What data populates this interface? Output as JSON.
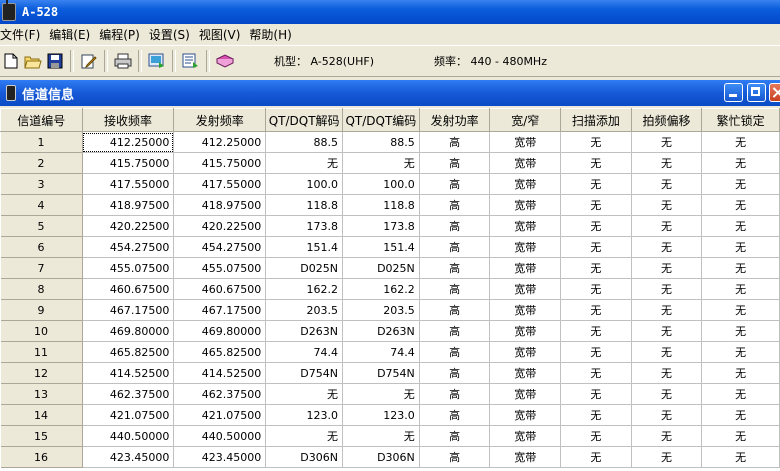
{
  "window": {
    "title": "A-528"
  },
  "menu": [
    "文件(F)",
    "编辑(E)",
    "编程(P)",
    "设置(S)",
    "视图(V)",
    "帮助(H)"
  ],
  "toolbar": {
    "icons": [
      "new-file-icon",
      "open-folder-icon",
      "save-disk-icon",
      "edit-icon",
      "print-icon",
      "read-radio-icon",
      "write-radio-icon",
      "book-icon"
    ],
    "model_label": "机型：",
    "model_value": "A-528(UHF)",
    "freq_label": "频率：",
    "freq_value": "440 - 480MHz"
  },
  "panel": {
    "title": "信道信息"
  },
  "table": {
    "headers": [
      "信道编号",
      "接收频率",
      "发射频率",
      "QT/DQT解码",
      "QT/DQT编码",
      "发射功率",
      "宽/窄",
      "扫描添加",
      "拍频偏移",
      "繁忙锁定"
    ],
    "rows": [
      [
        "1",
        "412.25000",
        "412.25000",
        "88.5",
        "88.5",
        "高",
        "宽带",
        "无",
        "无",
        "无"
      ],
      [
        "2",
        "415.75000",
        "415.75000",
        "无",
        "无",
        "高",
        "宽带",
        "无",
        "无",
        "无"
      ],
      [
        "3",
        "417.55000",
        "417.55000",
        "100.0",
        "100.0",
        "高",
        "宽带",
        "无",
        "无",
        "无"
      ],
      [
        "4",
        "418.97500",
        "418.97500",
        "118.8",
        "118.8",
        "高",
        "宽带",
        "无",
        "无",
        "无"
      ],
      [
        "5",
        "420.22500",
        "420.22500",
        "173.8",
        "173.8",
        "高",
        "宽带",
        "无",
        "无",
        "无"
      ],
      [
        "6",
        "454.27500",
        "454.27500",
        "151.4",
        "151.4",
        "高",
        "宽带",
        "无",
        "无",
        "无"
      ],
      [
        "7",
        "455.07500",
        "455.07500",
        "D025N",
        "D025N",
        "高",
        "宽带",
        "无",
        "无",
        "无"
      ],
      [
        "8",
        "460.67500",
        "460.67500",
        "162.2",
        "162.2",
        "高",
        "宽带",
        "无",
        "无",
        "无"
      ],
      [
        "9",
        "467.17500",
        "467.17500",
        "203.5",
        "203.5",
        "高",
        "宽带",
        "无",
        "无",
        "无"
      ],
      [
        "10",
        "469.80000",
        "469.80000",
        "D263N",
        "D263N",
        "高",
        "宽带",
        "无",
        "无",
        "无"
      ],
      [
        "11",
        "465.82500",
        "465.82500",
        "74.4",
        "74.4",
        "高",
        "宽带",
        "无",
        "无",
        "无"
      ],
      [
        "12",
        "414.52500",
        "414.52500",
        "D754N",
        "D754N",
        "高",
        "宽带",
        "无",
        "无",
        "无"
      ],
      [
        "13",
        "462.37500",
        "462.37500",
        "无",
        "无",
        "高",
        "宽带",
        "无",
        "无",
        "无"
      ],
      [
        "14",
        "421.07500",
        "421.07500",
        "123.0",
        "123.0",
        "高",
        "宽带",
        "无",
        "无",
        "无"
      ],
      [
        "15",
        "440.50000",
        "440.50000",
        "无",
        "无",
        "高",
        "宽带",
        "无",
        "无",
        "无"
      ],
      [
        "16",
        "423.45000",
        "423.45000",
        "D306N",
        "D306N",
        "高",
        "宽带",
        "无",
        "无",
        "无"
      ]
    ]
  }
}
